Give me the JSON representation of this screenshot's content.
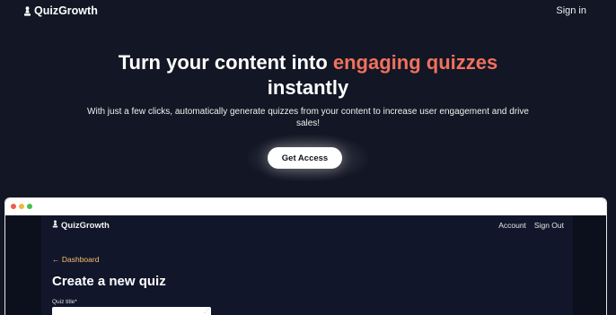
{
  "header": {
    "brand": "QuizGrowth",
    "brand_icon": "pawn-icon",
    "signin_label": "Sign in"
  },
  "hero": {
    "title_part1": "Turn your content into ",
    "title_accent": "engaging quizzes",
    "title_part2": "instantly",
    "subtitle": "With just a few clicks, automatically generate quizzes from your content to increase user engagement and drive sales!",
    "cta_label": "Get Access"
  },
  "preview": {
    "brand": "QuizGrowth",
    "nav": [
      "Account",
      "Sign Out"
    ],
    "back_link": "← Dashboard",
    "heading": "Create a new quiz",
    "field_label": "Quiz title*",
    "field_value": ""
  },
  "colors": {
    "background": "#131624",
    "accent": "#f0715d",
    "link": "#f3c06f",
    "button_bg": "#ffffff"
  }
}
